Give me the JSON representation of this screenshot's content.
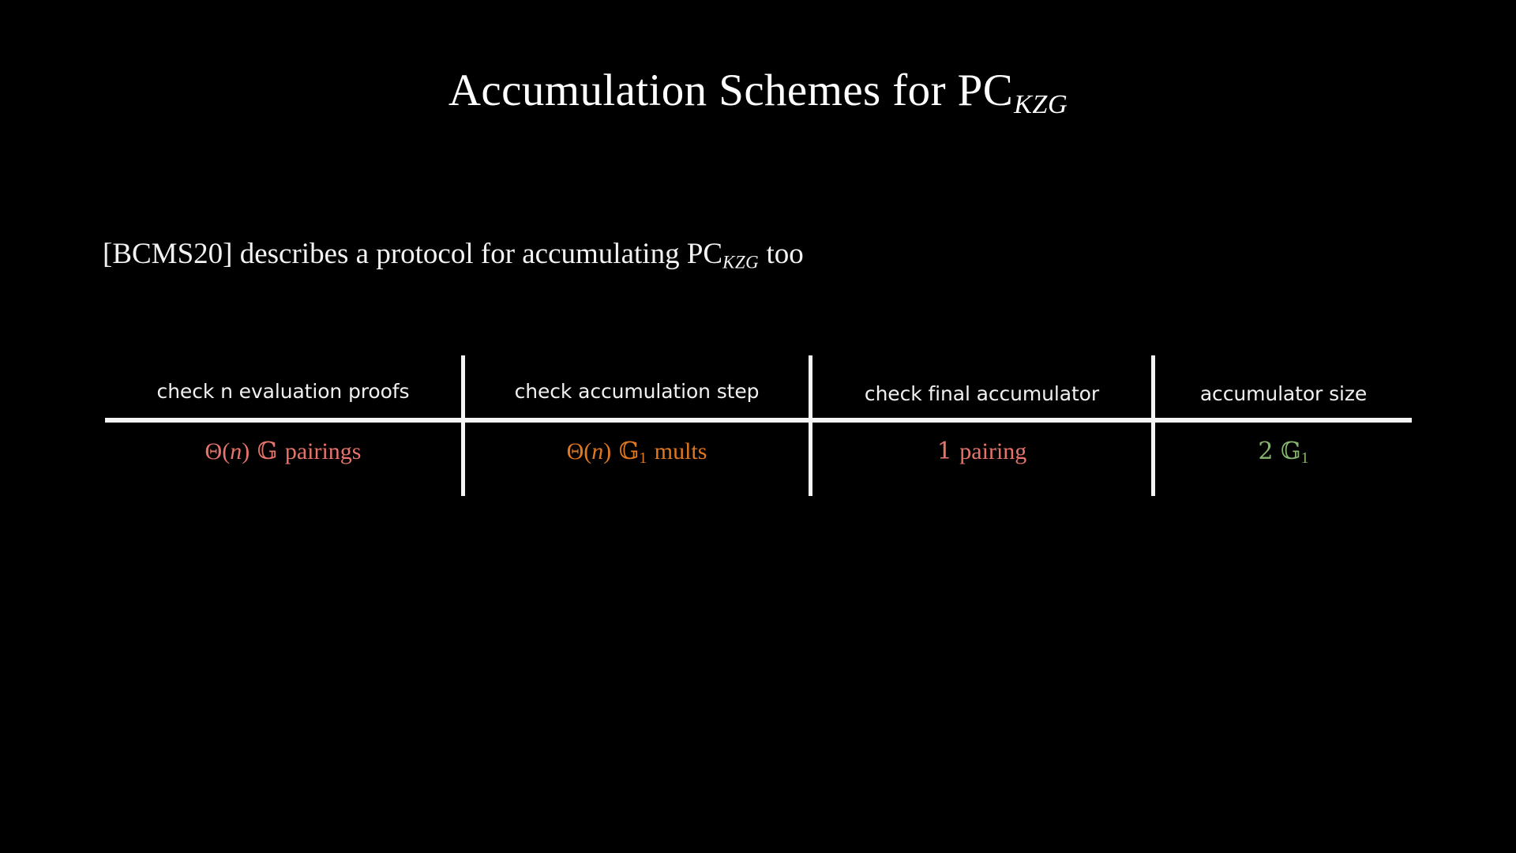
{
  "slide": {
    "background_color": "#000000",
    "title": {
      "main": "Accumulation Schemes for PC",
      "subscript": "KZG"
    },
    "body": {
      "before": "[BCMS20] describes a protocol for accumulating PC",
      "subscript": "KZG",
      "after": " too"
    }
  },
  "table": {
    "rule_color": "#f4f4f4",
    "separator_color": "#f4f4f4",
    "columns": [
      {
        "header": "check n evaluation proofs",
        "value_text": "Θ(n) 𝔾 pairings",
        "value_parts": {
          "theta": "Θ(",
          "n": "n",
          "close": ")",
          "group": "𝔾",
          "subscript": "",
          "unit": "pairings"
        },
        "value_color": "#e8736b"
      },
      {
        "header": "check accumulation step",
        "value_text": "Θ(n) 𝔾₁ mults",
        "value_parts": {
          "theta": "Θ(",
          "n": "n",
          "close": ")",
          "group": "𝔾",
          "subscript": "1",
          "unit": "mults"
        },
        "value_color": "#e07820"
      },
      {
        "header": "check final accumulator",
        "value_text": "1  pairing",
        "value_parts": {
          "theta": "",
          "n": "",
          "close": "",
          "group": "1",
          "subscript": "",
          "unit": "pairing"
        },
        "value_color": "#e8736b"
      },
      {
        "header": "accumulator size",
        "value_text": "2 𝔾₁",
        "value_parts": {
          "theta": "",
          "n": "",
          "close": "",
          "group": "2 𝔾",
          "subscript": "1",
          "unit": ""
        },
        "value_color": "#86b56e"
      }
    ]
  }
}
